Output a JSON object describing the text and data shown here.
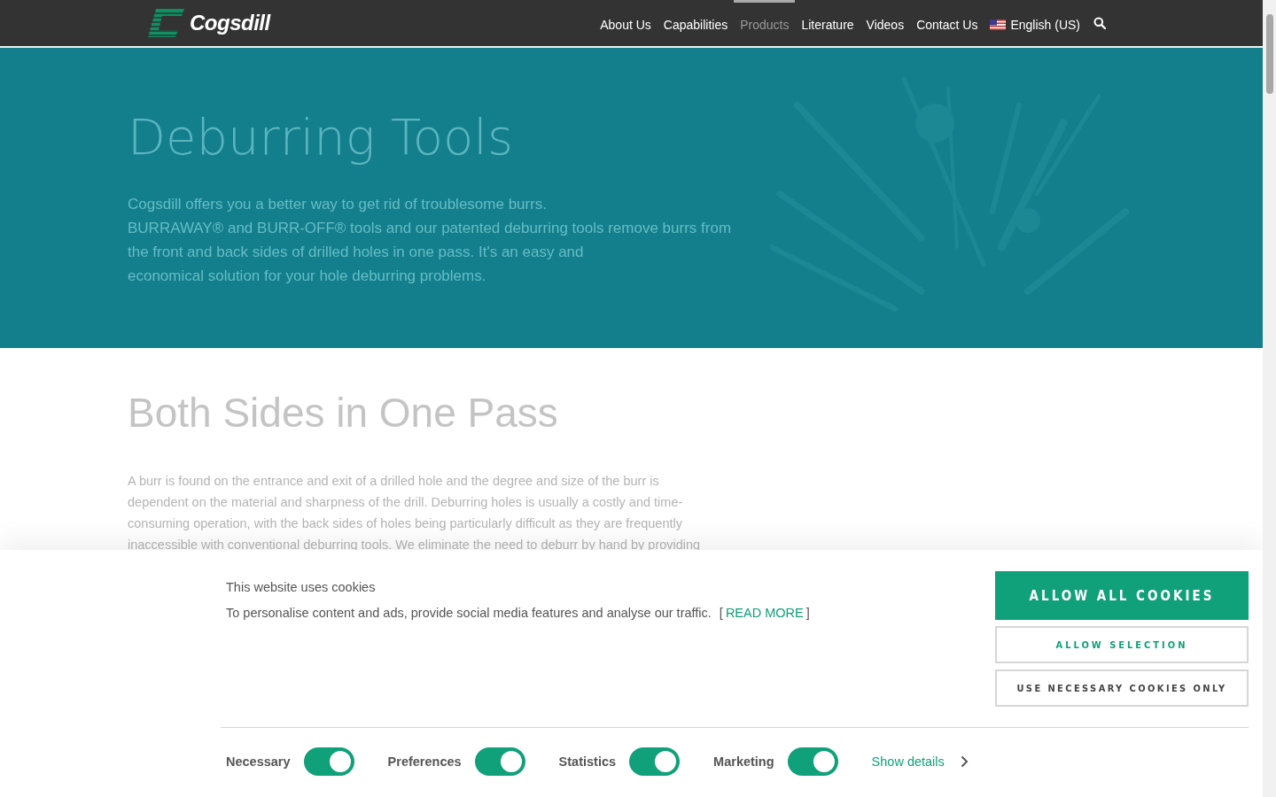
{
  "header": {
    "logo_text": "Cogsdill",
    "nav": [
      {
        "label": "About Us",
        "selected": false
      },
      {
        "label": "Capabilities",
        "selected": false
      },
      {
        "label": "Products",
        "selected": true
      },
      {
        "label": "Literature",
        "selected": false
      },
      {
        "label": "Videos",
        "selected": false
      },
      {
        "label": "Contact Us",
        "selected": false
      }
    ],
    "language": "English (US)"
  },
  "hero": {
    "title": "Deburring Tools",
    "lines": [
      "Cogsdill offers you a better way to get rid of troublesome burrs.",
      "BURRAWAY® and BURR-OFF® tools and our patented deburring tools remove burrs from",
      "the front and back sides of drilled holes in one pass. It's an easy and",
      "economical solution for your hole deburring problems."
    ]
  },
  "section": {
    "title": "Both Sides in One Pass",
    "lines": [
      "A burr is found on the entrance and exit of a drilled hole and the degree and size of the burr is",
      "dependent on the material and sharpness of the drill. Deburring holes is usually a costly and time-",
      "consuming operation, with the back sides of holes being particularly difficult as they are frequently",
      "inaccessible with conventional deburring tools. We eliminate the need to deburr by hand by providing"
    ]
  },
  "cookie_banner": {
    "title": "This website uses cookies",
    "text": "To personalise content and ads, provide social media features and analyse our traffic.",
    "read_more_open": "[",
    "read_more": "READ MORE",
    "read_more_close": "]",
    "buttons": [
      {
        "label": "ALLOW ALL COOKIES",
        "kind": "primary"
      },
      {
        "label": "ALLOW SELECTION",
        "kind": "secondary"
      },
      {
        "label": "USE NECESSARY COOKIES ONLY",
        "kind": "plain"
      }
    ],
    "toggles": [
      {
        "label": "Necessary",
        "on": true
      },
      {
        "label": "Preferences",
        "on": true
      },
      {
        "label": "Statistics",
        "on": true
      },
      {
        "label": "Marketing",
        "on": true
      }
    ],
    "show_details": "Show details"
  }
}
